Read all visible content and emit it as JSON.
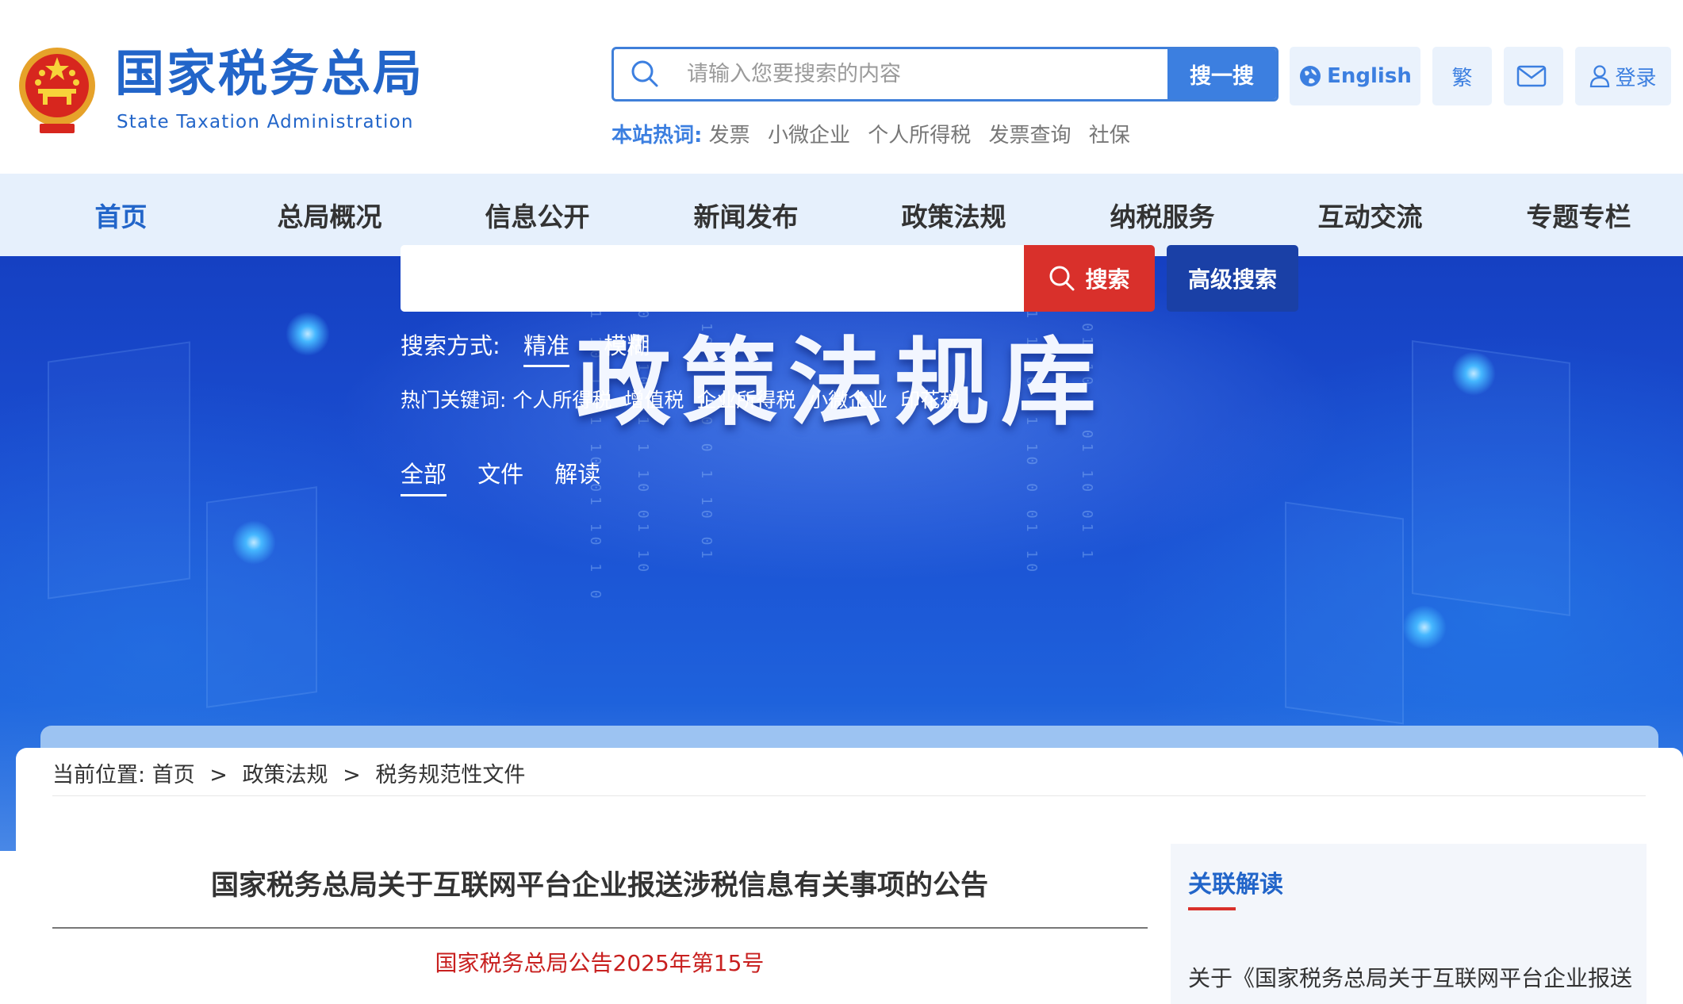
{
  "header": {
    "logo_cn": "国家税务总局",
    "logo_en": "State Taxation Administration",
    "search_placeholder": "请输入您要搜索的内容",
    "search_button": "搜一搜",
    "hot_label": "本站热词:",
    "hot_words": [
      "发票",
      "小微企业",
      "个人所得税",
      "发票查询",
      "社保"
    ],
    "english_label": "English",
    "traditional_label": "繁",
    "login_label": "登录"
  },
  "nav": {
    "items": [
      "首页",
      "总局概况",
      "信息公开",
      "新闻发布",
      "政策法规",
      "纳税服务",
      "互动交流",
      "专题专栏"
    ],
    "active_index": 0
  },
  "banner": {
    "title": "政策法规库",
    "tabs": [
      "全部",
      "文件",
      "解读"
    ],
    "active_tab": 0,
    "search_button": "搜索",
    "advanced_button": "高级搜索",
    "mode_label": "搜索方式:",
    "modes": [
      "精准",
      "模糊"
    ],
    "active_mode": 0,
    "hot_label": "热门关键词:",
    "hot_keywords": [
      "个人所得税",
      "增值税",
      "企业所得税",
      "小微企业",
      "印花税"
    ]
  },
  "breadcrumb": {
    "label": "当前位置:",
    "items": [
      "首页",
      "政策法规",
      "税务规范性文件"
    ],
    "separator": ">"
  },
  "article": {
    "title": "国家税务总局关于互联网平台企业报送涉税信息有关事项的公告",
    "number": "国家税务总局公告2025年第15号"
  },
  "sidebar": {
    "title": "关联解读",
    "first_link": "关于《国家税务总局关于互联网平台企业报送"
  },
  "colors": {
    "brand_blue": "#2265c9",
    "search_red": "#d9302b",
    "nav_bg": "#e6f0fc",
    "article_number_red": "#c8201f"
  }
}
